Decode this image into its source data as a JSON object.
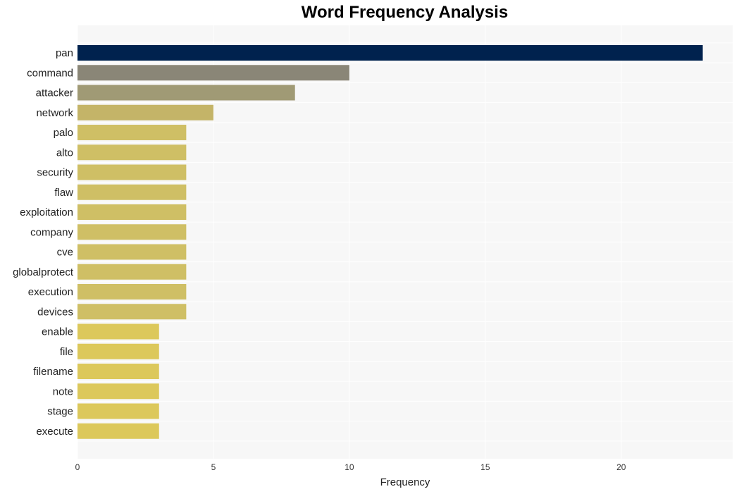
{
  "chart_data": {
    "type": "bar",
    "orientation": "horizontal",
    "title": "Word Frequency Analysis",
    "xlabel": "Frequency",
    "ylabel": "",
    "xlim": [
      0,
      24.1
    ],
    "xticks": [
      0,
      5,
      10,
      15,
      20
    ],
    "grid": true,
    "legend": "none",
    "categories": [
      "pan",
      "command",
      "attacker",
      "network",
      "palo",
      "alto",
      "security",
      "flaw",
      "exploitation",
      "company",
      "cve",
      "globalprotect",
      "execution",
      "devices",
      "enable",
      "file",
      "filename",
      "note",
      "stage",
      "execute"
    ],
    "values": [
      23,
      10,
      8,
      5,
      4,
      4,
      4,
      4,
      4,
      4,
      4,
      4,
      4,
      4,
      3,
      3,
      3,
      3,
      3,
      3
    ],
    "colors": [
      "#00224e",
      "#8a8677",
      "#a09a75",
      "#c4b468",
      "#cfbf65",
      "#cfbf65",
      "#cfbf65",
      "#cfbf65",
      "#cfbf65",
      "#cfbf65",
      "#cfbf65",
      "#cfbf65",
      "#cfbf65",
      "#cfbf65",
      "#dcc85b",
      "#dcc85b",
      "#dcc85b",
      "#dcc85b",
      "#dcc85b",
      "#dcc85b"
    ],
    "plot_background": "#f7f7f7",
    "grid_color": "#ffffff"
  }
}
